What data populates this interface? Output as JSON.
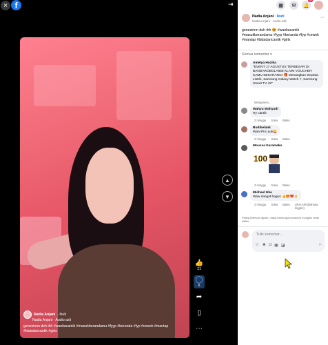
{
  "window": {
    "close_icon": "×",
    "fb_logo": "f",
    "collapse_icon": "⇥"
  },
  "video": {
    "author": "Nadia Anjani",
    "follow_label": "· Ikuti",
    "subline": "Nadia Anjani · Audio asli",
    "caption": "genesinnn deh ihh #wanitacantik #masukberandamu #fyyp #beranda #fyp #cewek #mantap #bidadaricantik #girls"
  },
  "side_actions": {
    "like_count": "21",
    "comment_count": "6"
  },
  "topbar": {
    "messenger_badge": "",
    "notif_badge": "9+"
  },
  "post": {
    "author": "Nadia Anjani",
    "follow_label": "· Ikuti",
    "subline": "Nadia Anjani · Audio asli",
    "caption": "genesinnn deh ihh 😍 #wanitacantik #masukberandamu #fyyp #beranda #fyp #cewek #mantap #bidadaricantik #girls"
  },
  "comments_header": {
    "sort_label": "Semua komentar ▾"
  },
  "comments": [
    {
      "name": "Amelya Hozika",
      "text": "\"EVENT 17 AGUSTUS TERBESAR DI BANDAROBOLA855 KLAIM VOUCHER KAMU SEKARANG! 🎁 Menangkan Sepeda Listrik, Samsung Galaxy Watch 7, Samsung Smart TV 43\"",
      "time": "Mengomen..."
    },
    {
      "name": "Wahyu Wahyudi",
      "text": "Hy cantik",
      "time": "2 minggu",
      "like": "Suka",
      "reply": "Balas"
    },
    {
      "name": "Budibelank",
      "text": "Wani Piro yuk😜",
      "time": "2 minggu",
      "like": "Suka",
      "reply": "Balas"
    },
    {
      "name": "Moussa Karameko",
      "text": "",
      "time": "2 minggu",
      "like": "Suka",
      "reply": "Balas"
    },
    {
      "name": "Michael Uka",
      "text": "Waw sangat bagus 👍😍❤️👌",
      "time": "2 minggu",
      "like": "Suka",
      "reply": "Balas",
      "translate": "Lihat Asli (Bahasa Inggris)"
    }
  ],
  "note": "Paling Relevan dipilih, maka beberapa komentar mungkin telah difilter.",
  "compose": {
    "placeholder": "Tulis komentar..."
  },
  "icons": [
    "close-icon",
    "facebook-logo",
    "collapse-icon",
    "like-icon",
    "comment-icon",
    "share-icon",
    "bookmark-icon",
    "more-icon",
    "menu-icon",
    "messenger-icon",
    "bell-icon",
    "send-icon"
  ]
}
